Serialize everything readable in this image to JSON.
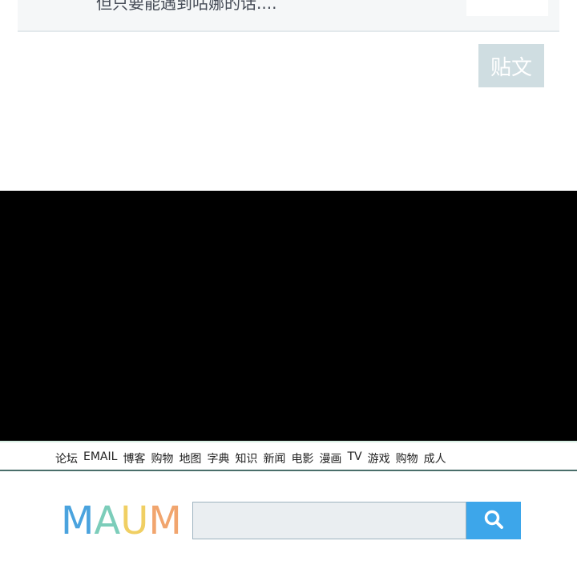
{
  "comment": {
    "text": "但只要能遇到咕娜的话...."
  },
  "post_button": {
    "label": "贴文"
  },
  "nav": {
    "links": [
      "论坛",
      "EMAIL",
      "博客",
      "购物",
      "地图",
      "字典",
      "知识",
      "新闻",
      "电影",
      "漫画",
      "TV",
      "游戏",
      "购物",
      "成人"
    ]
  },
  "logo": {
    "letters": [
      "M",
      "A",
      "U",
      "M"
    ]
  },
  "search": {
    "value": "",
    "placeholder": "",
    "icon": "search-icon"
  },
  "colors": {
    "accent": "#3da6ea",
    "logo_m": "#4aa3de",
    "logo_a": "#7ccdba",
    "logo_u": "#f0cf63",
    "logo_m2": "#f1a56e",
    "post_button": "#cfdde1"
  }
}
